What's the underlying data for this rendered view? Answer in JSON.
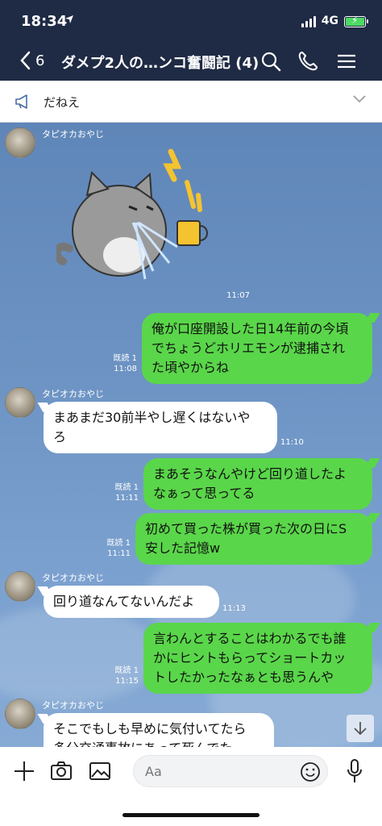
{
  "status": {
    "time": "18:34",
    "network": "4G"
  },
  "header": {
    "back_count": "6",
    "title": "ダメプ2人の…ンコ奮闘記 (4)"
  },
  "announcement": {
    "text": "だねえ"
  },
  "messages": [
    {
      "type": "sticker",
      "sender": "タピオカおやじ",
      "time": "11:07"
    },
    {
      "type": "out",
      "lines": [
        "俺が口座開設した日14年前の今頃",
        "でちょうどホリエモンが逮捕され",
        "た頃やからね"
      ],
      "read": "既読 1",
      "time": "11:08"
    },
    {
      "type": "in",
      "sender": "タピオカおやじ",
      "lines": [
        "まあまだ30前半やし遅くはないや",
        "ろ"
      ],
      "time": "11:10"
    },
    {
      "type": "out",
      "lines": [
        "まあそうなんやけど回り道したよ",
        "なぁって思ってる"
      ],
      "read": "既読 1",
      "time": "11:11"
    },
    {
      "type": "out",
      "lines": [
        "初めて買った株が買った次の日にS",
        "安した記憶w"
      ],
      "read": "既読 1",
      "time": "11:11"
    },
    {
      "type": "in",
      "sender": "タピオカおやじ",
      "lines": [
        "回り道なんてないんだよ"
      ],
      "time": "11:13"
    },
    {
      "type": "out",
      "lines": [
        "言わんとすることはわかるでも誰",
        "かにヒントもらってショートカッ",
        "トしたかったなぁとも思うんや"
      ],
      "read": "既読 1",
      "time": "11:15"
    },
    {
      "type": "in",
      "sender": "タピオカおやじ",
      "lines": [
        "そこでもしも早めに気付いてたら",
        "多分交通事故にあって死んでた"
      ]
    }
  ],
  "input": {
    "placeholder": "Aa"
  },
  "icons": {
    "back": "chevron-left-icon",
    "search": "search-icon",
    "call": "phone-icon",
    "menu": "hamburger-menu-icon",
    "announce": "megaphone-icon",
    "expand": "chevron-down-icon",
    "scroll": "arrow-down-icon",
    "plus": "plus-icon",
    "camera": "camera-icon",
    "image": "image-icon",
    "emoji": "emoji-icon",
    "mic": "microphone-icon"
  },
  "colors": {
    "header_bg": "#1f2a44",
    "out_bubble": "#5ad64a",
    "in_bubble": "#ffffff",
    "chat_bg": "#6c93c3"
  }
}
